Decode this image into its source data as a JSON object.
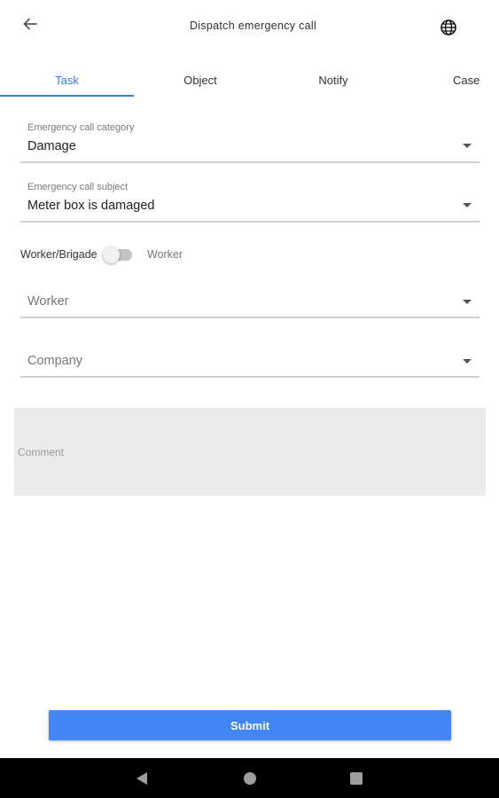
{
  "app_bar": {
    "title": "Dispatch emergency call",
    "back_icon": "arrow-left-icon",
    "language_icon": "globe-icon"
  },
  "tabs": [
    {
      "label": "Task",
      "active": true
    },
    {
      "label": "Object",
      "active": false
    },
    {
      "label": "Notify",
      "active": false
    },
    {
      "label": "Case",
      "active": false
    }
  ],
  "form": {
    "category": {
      "label": "Emergency call category",
      "value": "Damage"
    },
    "subject": {
      "label": "Emergency call subject",
      "value": "Meter box is damaged"
    },
    "assignee_toggle": {
      "left_label": "Worker/Brigade",
      "right_label": "Worker",
      "on": false
    },
    "worker": {
      "placeholder": "Worker"
    },
    "company": {
      "placeholder": "Company"
    },
    "comment": {
      "placeholder": "Comment"
    }
  },
  "submit": {
    "label": "Submit"
  },
  "colors": {
    "accent": "#3b7ddd",
    "button": "#4285f4",
    "comment_bg": "#ebebeb"
  }
}
